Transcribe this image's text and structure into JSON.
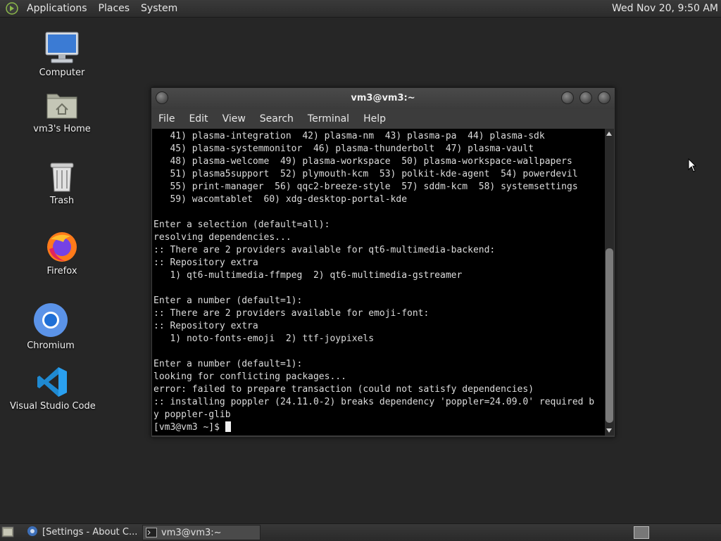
{
  "top_panel": {
    "menus": [
      "Applications",
      "Places",
      "System"
    ],
    "clock": "Wed Nov 20,  9:50 AM"
  },
  "desktop_icons": [
    {
      "label": "Computer",
      "icon": "computer-icon"
    },
    {
      "label": "vm3's Home",
      "icon": "home-folder-icon"
    },
    {
      "label": "Trash",
      "icon": "trash-icon"
    },
    {
      "label": "Firefox",
      "icon": "firefox-icon"
    },
    {
      "label": "Chromium",
      "icon": "chromium-icon"
    },
    {
      "label": "Visual Studio Code",
      "icon": "vscode-icon"
    }
  ],
  "terminal": {
    "title": "vm3@vm3:~",
    "menu": [
      "File",
      "Edit",
      "View",
      "Search",
      "Terminal",
      "Help"
    ],
    "lines": [
      "   41) plasma-integration  42) plasma-nm  43) plasma-pa  44) plasma-sdk",
      "   45) plasma-systemmonitor  46) plasma-thunderbolt  47) plasma-vault",
      "   48) plasma-welcome  49) plasma-workspace  50) plasma-workspace-wallpapers",
      "   51) plasma5support  52) plymouth-kcm  53) polkit-kde-agent  54) powerdevil",
      "   55) print-manager  56) qqc2-breeze-style  57) sddm-kcm  58) systemsettings",
      "   59) wacomtablet  60) xdg-desktop-portal-kde",
      "",
      "Enter a selection (default=all):",
      "resolving dependencies...",
      ":: There are 2 providers available for qt6-multimedia-backend:",
      ":: Repository extra",
      "   1) qt6-multimedia-ffmpeg  2) qt6-multimedia-gstreamer",
      "",
      "Enter a number (default=1):",
      ":: There are 2 providers available for emoji-font:",
      ":: Repository extra",
      "   1) noto-fonts-emoji  2) ttf-joypixels",
      "",
      "Enter a number (default=1):",
      "looking for conflicting packages...",
      "error: failed to prepare transaction (could not satisfy dependencies)",
      ":: installing poppler (24.11.0-2) breaks dependency 'poppler=24.09.0' required b",
      "y poppler-glib"
    ],
    "prompt": "[vm3@vm3 ~]$ "
  },
  "taskbar": {
    "tasks": [
      {
        "label": "[Settings - About C...",
        "active": false
      },
      {
        "label": "vm3@vm3:~",
        "active": true
      }
    ]
  }
}
